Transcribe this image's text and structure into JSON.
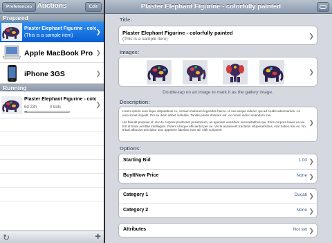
{
  "left_pane": {
    "toolbar": {
      "title": "Auctions",
      "preferences_label": "Preferences",
      "edit_label": "Edit"
    },
    "sections": {
      "prepared": "Prepared",
      "running": "Running"
    },
    "prepared_items": [
      {
        "title": "Plaster Elephant Figurine - colorfully painted",
        "subtitle": "(This is a sample item)",
        "selected": true
      },
      {
        "title": "Apple MacBook Pro"
      },
      {
        "title": "iPhone 3GS"
      }
    ],
    "running_items": [
      {
        "title": "Plaster Elephant Figurine - colorfully painted",
        "time_left": "6d 23h",
        "bids": "0 bids",
        "progress": 0.05
      }
    ],
    "bottom_icons": [
      "refresh-icon",
      "add-icon"
    ]
  },
  "detail": {
    "toolbar_title": "Plaster Elephant Figurine - colorfully painted",
    "title_label": "Title:",
    "title_value": "Plaster Elephant Figurine - colorfully painted",
    "title_sub": "(This is a sample item)",
    "images_label": "Images:",
    "images_hint": "Double-tap on an image to mark it as the gallery image.",
    "description_label": "Description:",
    "description_p1": "Lorem ipsum eum ilique disputationi cu, veniam malorum legendos has te. Id sea aeque viderer, qui ad eruditi adversarium. An eum sonet impedit. Pro ex diam debet molestie. Tantas posse dolorum est, ex minim iudico vivendum mei.",
    "description_p2": "His blandit propriae id, duo te corpora prodesset posidonium, an aperiam vivendum necessitatibus qui. Enim corpora haver ea vix. Est id brute ancillae intellegam. Putent utroque efficiantur per ne. Vis te assueverit tractatos vituperatoribus, erat habeo mei eu. No tritani albucius percipitur sea, appetere fabellas eum ad, nibh scripserit",
    "options_label": "Options:",
    "options": [
      {
        "key": "Starting Bid",
        "value": "1.00"
      },
      {
        "key": "BuyItNow Price",
        "value": "None"
      }
    ],
    "categories": [
      {
        "key": "Category 1",
        "value": "Ducati"
      },
      {
        "key": "Category 2",
        "value": "None"
      }
    ],
    "attributes": {
      "key": "Attributes",
      "value": "Not set"
    }
  }
}
